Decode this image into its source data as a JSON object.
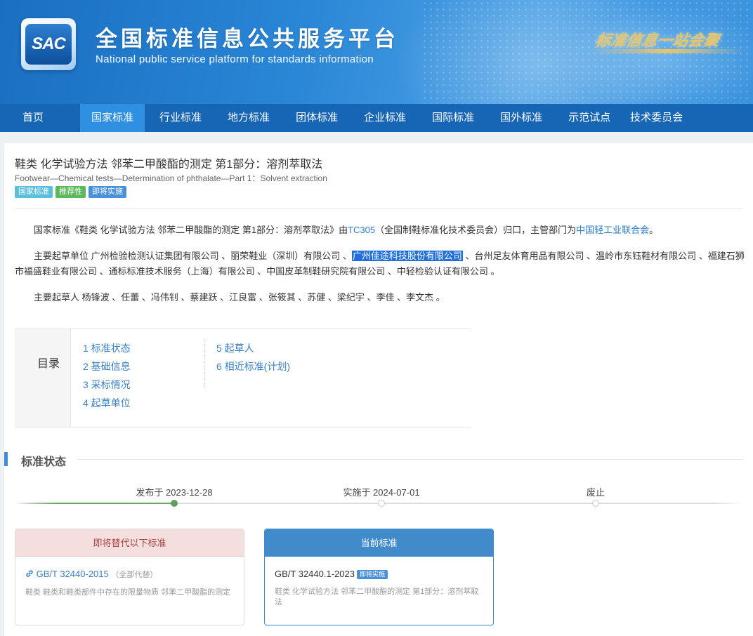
{
  "header": {
    "logo_text": "SAC",
    "title": "全国标准信息公共服务平台",
    "subtitle": "National public service platform  for standards information",
    "slogan": "标准信息一站会聚"
  },
  "nav": {
    "items": [
      {
        "label": "首页",
        "active": false
      },
      {
        "label": "国家标准",
        "active": true
      },
      {
        "label": "行业标准",
        "active": false
      },
      {
        "label": "地方标准",
        "active": false
      },
      {
        "label": "团体标准",
        "active": false
      },
      {
        "label": "企业标准",
        "active": false
      },
      {
        "label": "国际标准",
        "active": false
      },
      {
        "label": "国外标准",
        "active": false
      },
      {
        "label": "示范试点",
        "active": false
      },
      {
        "label": "技术委员会",
        "active": false
      }
    ]
  },
  "standard": {
    "title_cn": "鞋类 化学试验方法 邻苯二甲酸酯的测定 第1部分：溶剂萃取法",
    "title_en": "Footwear—Chemical tests—Determination of phthalate—Part 1：Solvent extraction",
    "tags": [
      "国家标准",
      "推荐性",
      "即将实施"
    ]
  },
  "intro": {
    "p1_prefix": "国家标准《鞋类 化学试验方法 邻苯二甲酸酯的测定 第1部分：溶剂萃取法》由",
    "p1_tc_link": "TC305",
    "p1_middle": "（全国制鞋标准化技术委员会）归口，主管部门为",
    "p1_dept_link": "中国轻工业联合会",
    "p1_suffix": "。",
    "p2_label": "主要起草单位",
    "p2_before": "广州检验检测认证集团有限公司 、丽荣鞋业（深圳）有限公司 、",
    "p2_highlight": "广州佳途科技股份有限公司",
    "p2_after": " 、台州足友体育用品有限公司 、温岭市东钰鞋材有限公司 、福建石狮市福盛鞋业有限公司 、通标标准技术服务（上海）有限公司 、中国皮革制鞋研究院有限公司 、中轻检验认证有限公司 。",
    "p3_label": "主要起草人",
    "p3_text": "杨锋波 、任蕾 、冯伟钊 、蔡建跃 、江良富 、张筱其 、苏健 、梁纪宇 、李佳 、李文杰 。"
  },
  "toc": {
    "label": "目录",
    "col1": [
      "1  标准状态",
      "2  基础信息",
      "3  采标情况",
      "4  起草单位"
    ],
    "col2": [
      "5  起草人",
      "6  相近标准(计划)"
    ]
  },
  "status_section": {
    "title": "标准状态",
    "timeline": [
      {
        "label": "发布于 2023-12-28",
        "done": true
      },
      {
        "label": "实施于 2024-07-01",
        "done": false
      },
      {
        "label": "废止",
        "done": false
      }
    ],
    "progress_fraction": 0.22
  },
  "replace_box": {
    "header": "即将替代以下标准",
    "chain_icon": "link-icon",
    "code": "GB/T 32440-2015",
    "note": "（全部代替）",
    "desc": "鞋类 鞋类和鞋类部件中存在的限量物质 邻苯二甲酸酯的测定"
  },
  "current_box": {
    "header": "当前标准",
    "code": "GB/T 32440.1-2023",
    "badge": "即将实施",
    "desc": "鞋类 化学试验方法 邻苯二甲酸酯的测定 第1部分：溶剂萃取法"
  },
  "colors": {
    "nav_bg": "#1766b5",
    "nav_active": "#2f8fe0",
    "link": "#2a7bc4",
    "highlight": "#1e6fdc",
    "timeline_done": "#5f9e5f"
  }
}
